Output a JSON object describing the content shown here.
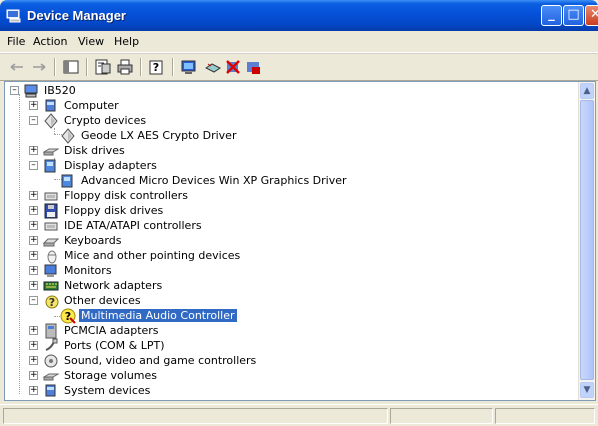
{
  "window": {
    "title": "Device Manager",
    "controls": {
      "minimize": "_",
      "maximize": "□",
      "close": "✕"
    }
  },
  "menu": [
    {
      "label": "File"
    },
    {
      "label": "Action"
    },
    {
      "label": "View"
    },
    {
      "label": "Help"
    }
  ],
  "toolbar": {
    "icons": [
      "back-arrow-icon",
      "forward-arrow-icon",
      "console-tree-icon",
      "properties-icon",
      "print-icon",
      "help-icon",
      "scan-hardware-icon",
      "update-driver-icon",
      "uninstall-icon",
      "disable-icon"
    ]
  },
  "tree": {
    "root": "IB520",
    "items": [
      {
        "label": "Computer",
        "icon": "computer-icon",
        "level": 1,
        "expand": "+"
      },
      {
        "label": "Crypto devices",
        "icon": "crypto-icon",
        "level": 1,
        "expand": "-"
      },
      {
        "label": "Geode LX AES Crypto Driver",
        "icon": "crypto-icon",
        "level": 2,
        "expand": ""
      },
      {
        "label": "Disk drives",
        "icon": "disk-icon",
        "level": 1,
        "expand": "+"
      },
      {
        "label": "Display adapters",
        "icon": "display-icon",
        "level": 1,
        "expand": "-"
      },
      {
        "label": "Advanced Micro Devices Win XP Graphics Driver",
        "icon": "display-icon",
        "level": 2,
        "expand": ""
      },
      {
        "label": "Floppy disk controllers",
        "icon": "controller-icon",
        "level": 1,
        "expand": "+"
      },
      {
        "label": "Floppy disk drives",
        "icon": "floppy-icon",
        "level": 1,
        "expand": "+"
      },
      {
        "label": "IDE ATA/ATAPI controllers",
        "icon": "controller-icon",
        "level": 1,
        "expand": "+"
      },
      {
        "label": "Keyboards",
        "icon": "keyboard-icon",
        "level": 1,
        "expand": "+"
      },
      {
        "label": "Mice and other pointing devices",
        "icon": "mouse-icon",
        "level": 1,
        "expand": "+"
      },
      {
        "label": "Monitors",
        "icon": "monitor-icon",
        "level": 1,
        "expand": "+"
      },
      {
        "label": "Network adapters",
        "icon": "network-icon",
        "level": 1,
        "expand": "+"
      },
      {
        "label": "Other devices",
        "icon": "unknown-device-icon",
        "level": 1,
        "expand": "-"
      },
      {
        "label": "Multimedia Audio Controller",
        "icon": "warning-device-icon",
        "level": 2,
        "expand": "",
        "selected": true
      },
      {
        "label": "PCMCIA adapters",
        "icon": "pcmcia-icon",
        "level": 1,
        "expand": "+"
      },
      {
        "label": "Ports (COM & LPT)",
        "icon": "port-icon",
        "level": 1,
        "expand": "+"
      },
      {
        "label": "Sound, video and game controllers",
        "icon": "sound-icon",
        "level": 1,
        "expand": "+"
      },
      {
        "label": "Storage volumes",
        "icon": "disk-icon",
        "level": 1,
        "expand": "+"
      },
      {
        "label": "System devices",
        "icon": "computer-icon",
        "level": 1,
        "expand": "+"
      }
    ]
  },
  "colors": {
    "selection": "#316ac5",
    "titlebar": "#0550d8"
  }
}
